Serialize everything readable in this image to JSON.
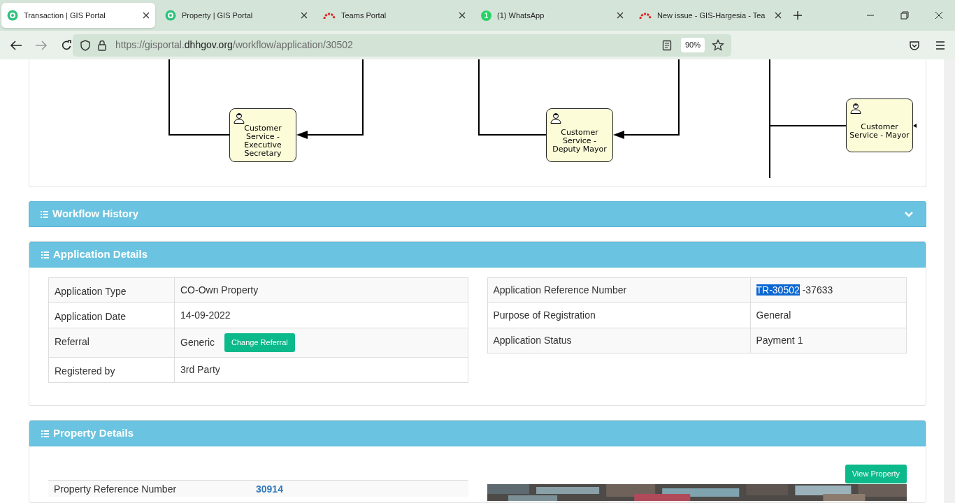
{
  "browser": {
    "tabs": [
      {
        "title": "Transaction | GIS Portal",
        "kind": "gis",
        "selected": true
      },
      {
        "title": "Property | GIS Portal",
        "kind": "gis",
        "selected": false
      },
      {
        "title": "Teams Portal",
        "kind": "teams",
        "selected": false
      },
      {
        "title": "(1) WhatsApp",
        "kind": "whatsapp",
        "badge": "1",
        "selected": false
      },
      {
        "title": "New issue - GIS-Hargesia - Tea",
        "kind": "teams",
        "selected": false
      }
    ],
    "url": {
      "prefix": "https://gisportal.",
      "domain": "dhhgov.org",
      "path": "/workflow/application/30502"
    },
    "zoom": "90%"
  },
  "diagram": {
    "nodes": [
      {
        "label": "Customer Service - Executive Secretary"
      },
      {
        "label": "Customer Service - Deputy Mayor"
      },
      {
        "label": "Customer Service - Mayor"
      }
    ]
  },
  "workflow_history": {
    "title": "Workflow History",
    "expanded": false
  },
  "application_details": {
    "title": "Application Details",
    "left_rows": [
      {
        "label": "Application Type",
        "value": "CO-Own Property"
      },
      {
        "label": "Application Date",
        "value": "14-09-2022"
      },
      {
        "label": "Referral",
        "value": "Generic",
        "button": "Change Referral"
      },
      {
        "label": "Registered by",
        "value": "3rd Party"
      }
    ],
    "right_rows": [
      {
        "label": "Application Reference Number",
        "value": "-37633",
        "selected_text": "TR-30502"
      },
      {
        "label": "Purpose of Registration",
        "value": "General"
      },
      {
        "label": "Application Status",
        "value": "Payment 1"
      }
    ]
  },
  "property_details": {
    "title": "Property Details",
    "button": "View Property",
    "rows": [
      {
        "label": "Property Reference Number",
        "value": "30914"
      }
    ]
  }
}
